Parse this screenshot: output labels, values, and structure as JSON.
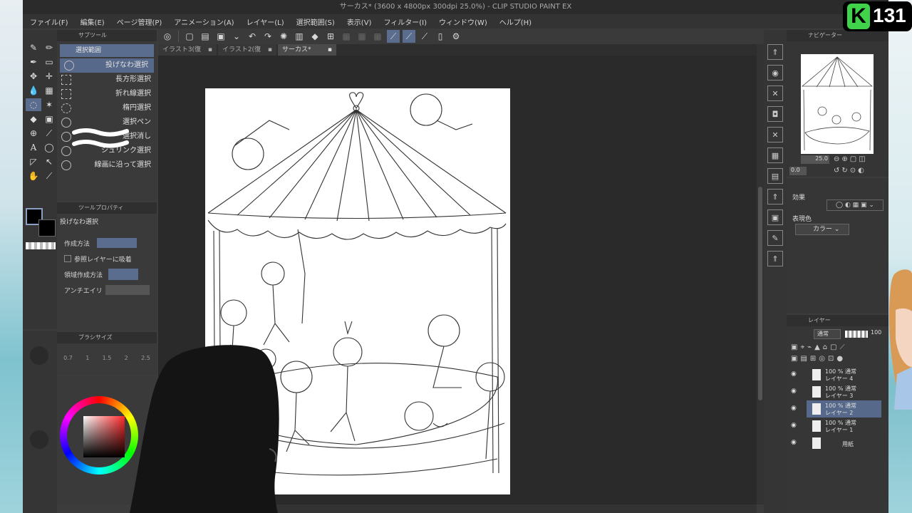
{
  "window": {
    "title": "サーカス* (3600 x 4800px 300dpi 25.0%) - CLIP STUDIO PAINT EX"
  },
  "menu": [
    "ファイル(F)",
    "編集(E)",
    "ページ管理(P)",
    "アニメーション(A)",
    "レイヤー(L)",
    "選択範囲(S)",
    "表示(V)",
    "フィルター(I)",
    "ウィンドウ(W)",
    "ヘルプ(H)"
  ],
  "tabs": [
    {
      "label": "イラスト3(復元)*"
    },
    {
      "label": "イラスト2(復元)*"
    },
    {
      "label": "サーカス*"
    }
  ],
  "subtool": {
    "header": "サブツール",
    "group": "選択範囲",
    "items": [
      {
        "label": "投げなわ選択",
        "selected": true
      },
      {
        "label": "長方形選択"
      },
      {
        "label": "折れ線選択"
      },
      {
        "label": "楕円選択"
      },
      {
        "label": "選択ペン"
      },
      {
        "label": "選択消し"
      },
      {
        "label": "シュリンク選択"
      },
      {
        "label": "線画に沿って選択"
      }
    ]
  },
  "tool_property": {
    "header": "ツールプロパティ",
    "tool_name": "投げなわ選択",
    "rows": [
      {
        "label": "作成方法"
      },
      {
        "label": "参照レイヤーに吸着"
      },
      {
        "label": "領域作成方法"
      },
      {
        "label": "アンチエイリ"
      }
    ]
  },
  "brush_size": {
    "header": "ブラシサイズ",
    "values": [
      "0.7",
      "1",
      "1.5",
      "2",
      "2.5"
    ]
  },
  "navigator": {
    "header": "ナビゲーター",
    "zoom": "25.0",
    "angle": "0.0"
  },
  "effect": {
    "label": "効果",
    "expression_label": "表現色",
    "expression_value": "カラー"
  },
  "layer_panel": {
    "header": "レイヤー",
    "blend_mode": "通常",
    "opacity": "100",
    "layers": [
      {
        "opacity_mode": "100 % 通常",
        "name": "レイヤー 4"
      },
      {
        "opacity_mode": "100 % 通常",
        "name": "レイヤー 3"
      },
      {
        "opacity_mode": "100 % 通常",
        "name": "レイヤー 2",
        "selected": true
      },
      {
        "opacity_mode": "100 % 通常",
        "name": "レイヤー 1"
      },
      {
        "opacity_mode": "",
        "name": "用紙"
      }
    ]
  },
  "stream_badge": {
    "letter": "K",
    "number": "131"
  },
  "colors": {
    "accent": "#5a6d8e",
    "badge_green": "#3fd24a",
    "panel": "#3a3a3a"
  }
}
